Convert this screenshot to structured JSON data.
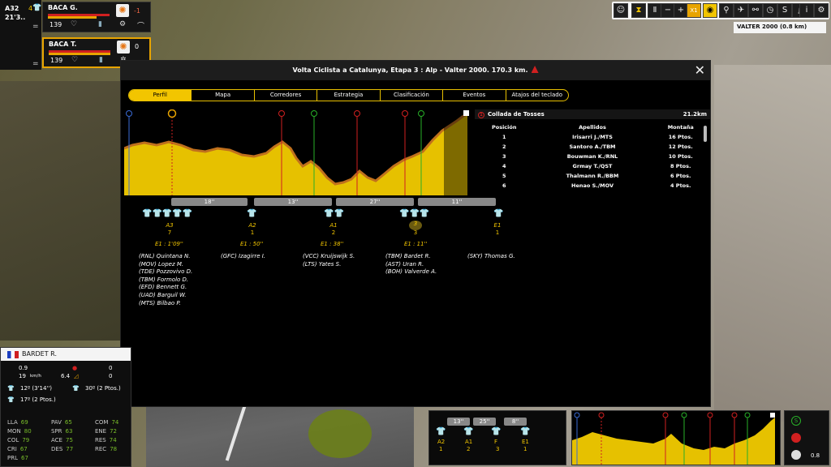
{
  "top_left": {
    "group": "A32",
    "time": "21'3..",
    "jersey_count": "4"
  },
  "riders": [
    {
      "name": "BACA G.",
      "energy": "139",
      "value": "-1"
    },
    {
      "name": "BACA T.",
      "energy": "139",
      "value": "0"
    }
  ],
  "location": {
    "label": "VALTER 2000 (0.8 km)"
  },
  "toolbar": {
    "speed": "X1"
  },
  "panel": {
    "title": "Volta Ciclista a Catalunya, Etapa 3 : Alp - Valter 2000. 170.3 km.",
    "tabs": [
      "Perfil",
      "Mapa",
      "Corredores",
      "Estrategia",
      "Clasificación",
      "Eventos",
      "Atajos del teclado"
    ],
    "gaps": [
      "18''",
      "13''",
      "27''",
      "11''"
    ],
    "sprints": [
      {
        "cat": "A3",
        "count": "7",
        "time": "E1 : 1'09''",
        "riders": [
          "(RNL) Quintana N.",
          "(MOV) Lopez M.",
          "(TDE) Pozzovivo D.",
          "(TBM) Formolo D.",
          "(EFD) Bennett G.",
          "(UAD) Barguil W.",
          "(MTS) Bilbao P."
        ]
      },
      {
        "cat": "A2",
        "count": "1",
        "time": "E1 : 50''",
        "riders": [
          "(GFC) Izagirre I."
        ]
      },
      {
        "cat": "A1",
        "count": "2",
        "time": "E1 : 38''",
        "riders": [
          "(VCC) Kruijswijk S.",
          "(LTS) Yates S."
        ]
      },
      {
        "cat": "3",
        "count": "3",
        "time": "E1 : 11''",
        "riders": [
          "(TBM) Bardet R.",
          "(AST) Uran R.",
          "(BOH) Valverde A."
        ]
      },
      {
        "cat": "E1",
        "count": "1",
        "time": "",
        "riders": [
          "(SKY) Thomas G."
        ]
      }
    ],
    "climb": {
      "name": "Collada de Tosses",
      "distance": "21.2km"
    },
    "classification": {
      "headers": [
        "Posición",
        "Apellidos",
        "Montaña"
      ],
      "rows": [
        [
          "1",
          "Irisarri J./MTS",
          "16 Ptos."
        ],
        [
          "2",
          "Santoro A./TBM",
          "12 Ptos."
        ],
        [
          "3",
          "Bouwman K./RNL",
          "10 Ptos."
        ],
        [
          "4",
          "Grmay T./QST",
          "8 Ptos."
        ],
        [
          "5",
          "Thalmann R./BBM",
          "6 Ptos."
        ],
        [
          "6",
          "Henao S./MOV",
          "4 Ptos."
        ]
      ]
    }
  },
  "rider_panel": {
    "name": "BARDET R.",
    "r1a": "0.9",
    "r1b": "0",
    "speed": "19",
    "speed_unit": "km/h",
    "grade": "6.4",
    "r2b": "0",
    "pos_yellow": "12º (3'14'')",
    "pos_green": "30º (2 Ptos.)",
    "pos_polka": "17º (2 Ptos.)",
    "stats": [
      [
        "LLA",
        "69"
      ],
      [
        "PAV",
        "65"
      ],
      [
        "COM",
        "74"
      ],
      [
        "MON",
        "80"
      ],
      [
        "SPR",
        "63"
      ],
      [
        "ENE",
        "72"
      ],
      [
        "COL",
        "79"
      ],
      [
        "ACE",
        "75"
      ],
      [
        "RES",
        "74"
      ],
      [
        "CRI",
        "67"
      ],
      [
        "DES",
        "77"
      ],
      [
        "REC",
        "78"
      ],
      [
        "PRL",
        "67"
      ]
    ]
  },
  "mini": {
    "gaps": [
      "13''",
      "25''",
      "8''"
    ],
    "cats": [
      "A2",
      "A1",
      "F",
      "E1"
    ],
    "counts": [
      "1",
      "2",
      "3",
      "1"
    ]
  },
  "side": {
    "value": "0.8"
  }
}
